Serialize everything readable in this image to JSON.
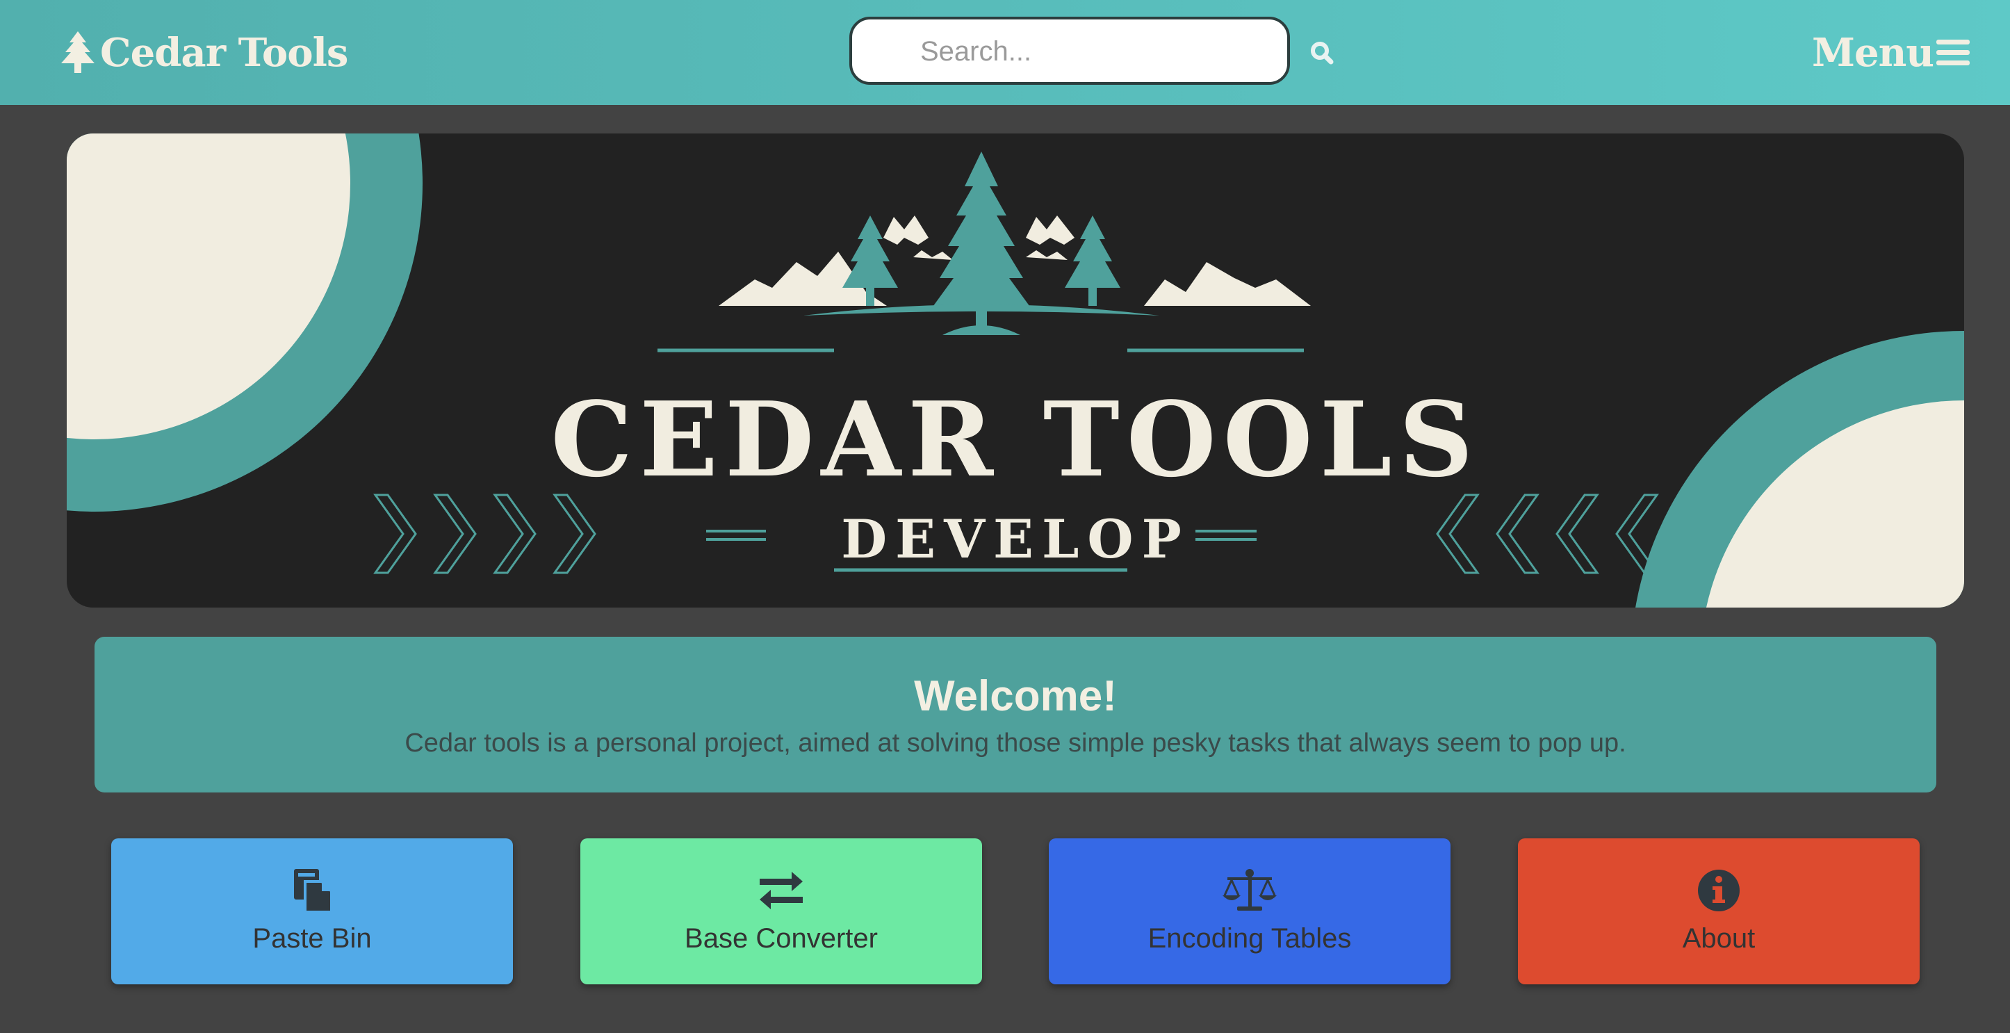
{
  "header": {
    "brand": "Cedar Tools",
    "search_placeholder": "Search...",
    "menu_label": "Menu"
  },
  "banner": {
    "title": "CEDAR TOOLS",
    "subtitle": "DEVELOP"
  },
  "welcome": {
    "heading": "Welcome!",
    "text": "Cedar tools is a personal project, aimed at solving those simple pesky tasks that always seem to pop up."
  },
  "tools": [
    {
      "label": "Paste Bin",
      "icon": "paste-icon",
      "color": "#52aae8"
    },
    {
      "label": "Base Converter",
      "icon": "exchange-arrows-icon",
      "color": "#6de9a3"
    },
    {
      "label": "Encoding Tables",
      "icon": "scale-icon",
      "color": "#3669e6"
    },
    {
      "label": "About",
      "icon": "info-icon",
      "color": "#dd4b2f"
    }
  ],
  "colors": {
    "header": "#5ec9c7",
    "background": "#434343",
    "teal": "#4fa19c",
    "cream": "#f1ede0"
  }
}
